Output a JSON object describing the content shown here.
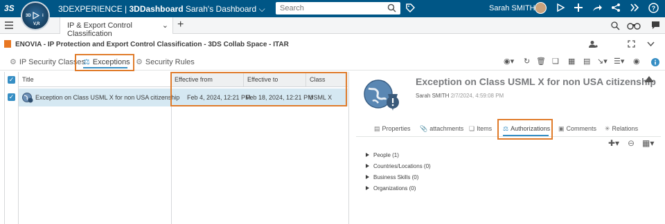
{
  "topbar": {
    "logo": "3S",
    "compass_labels": [
      "3D",
      "V,R",
      "i"
    ],
    "brand_prefix": "3DEXPERIENCE",
    "brand_app": "3DDashboard",
    "dashboard_name": "Sarah's Dashboard",
    "search_placeholder": "Search",
    "user_name": "Sarah SMITH",
    "background": "#005686"
  },
  "tabbar": {
    "active_tab": "IP & Export Control Classification",
    "add_label": "+"
  },
  "app": {
    "title": "ENOVIA - IP Protection and Export Control Classification - 3DS Collab Space - ITAR"
  },
  "subtabs": {
    "items": [
      {
        "label": "IP Security Classes"
      },
      {
        "label": "Exceptions",
        "active": true
      },
      {
        "label": "Security Rules"
      }
    ]
  },
  "grid": {
    "columns": [
      "Title",
      "Effective from",
      "Effective to",
      "Class"
    ],
    "rows": [
      {
        "title": "Exception on Class USML X for non USA citizenship",
        "effective_from": "Feb 4, 2024, 12:21 PM",
        "effective_to": "Feb 18, 2024, 12:21 PM",
        "class": "USML X",
        "selected": true
      }
    ]
  },
  "detail": {
    "title": "Exception on Class USML X for non USA citizenship",
    "owner": "Sarah SMITH",
    "date": "2/7/2024, 4:59:08 PM",
    "tabs": [
      "Properties",
      "attachments",
      "Items",
      "Authorizations",
      "Comments",
      "Relations"
    ],
    "active_tab": "Authorizations",
    "tree": [
      {
        "label": "People (1)"
      },
      {
        "label": "Countries/Locations (0)"
      },
      {
        "label": "Business Skills (0)"
      },
      {
        "label": "Organizations (0)"
      }
    ]
  },
  "colors": {
    "accent_blue": "#368ec4",
    "highlight_orange": "#e07b2a",
    "selected_row": "#d5e8f2"
  }
}
